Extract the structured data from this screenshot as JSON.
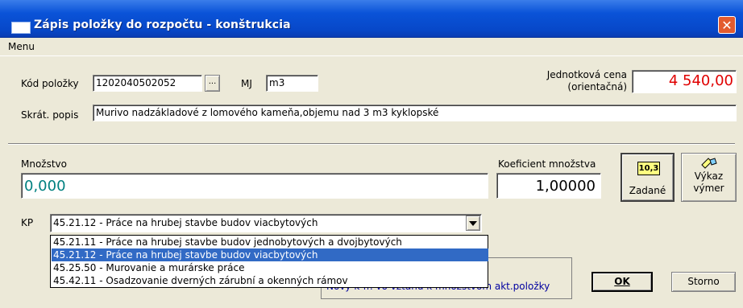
{
  "window": {
    "title": "Zápis položky do rozpočtu - konštrukcia",
    "close_glyph": "✕"
  },
  "menu": {
    "label": "Menu"
  },
  "kod": {
    "label": "Kód položky",
    "value": "1202040502052",
    "browse_label": "..."
  },
  "mj": {
    "label": "MJ",
    "value": "m3"
  },
  "cena": {
    "label_line1": "Jednotková cena",
    "label_line2": "(orientačná)",
    "value": "4 540,00",
    "color": "#e00000"
  },
  "popis": {
    "label": "Skrát. popis",
    "value": "Murivo nadzákladové z lomového kameňa,objemu nad 3 m3 kyklopské"
  },
  "mnozstvo": {
    "label": "Množstvo",
    "value": "0,000",
    "color": "#008080"
  },
  "koef": {
    "label": "Koeficient množstva",
    "value": "1,00000"
  },
  "zadane": {
    "icon_text": "10,3",
    "label": "Zadané"
  },
  "vykaz": {
    "label_line1": "Výkaz",
    "label_line2": "výmer",
    "icon": "pencil-ruler-icon"
  },
  "kp": {
    "label": "KP",
    "selected": "45.21.12 - Práce na hrubej stavbe budov viacbytových",
    "options": [
      "45.21.11 - Práce na hrubej stavbe budov jednobytových a dvojbytových",
      "45.21.12 - Práce na hrubej stavbe budov viacbytových",
      "45.25.50 - Murovanie a murárske práce",
      "45.42.11 - Osadzovanie dverných zárubní a okenných rámov"
    ],
    "highlighted_index": 1
  },
  "info": {
    "text": "Nový k-ff. vo vzťahu k množstvom akt.položky"
  },
  "ok": {
    "label": "OK"
  },
  "storno": {
    "label": "Storno"
  }
}
